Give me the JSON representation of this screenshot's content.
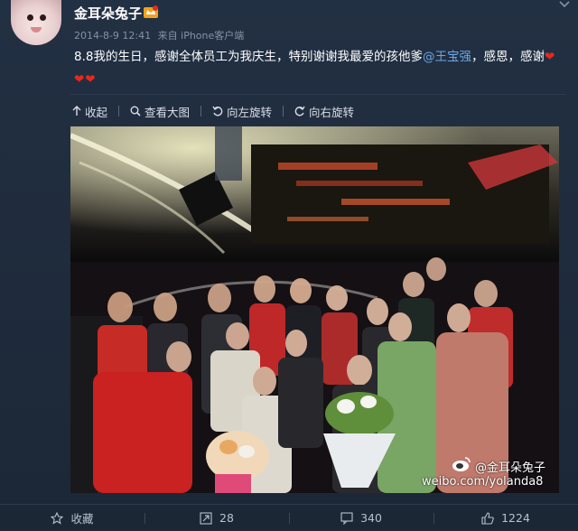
{
  "post": {
    "username": "金耳朵兔子",
    "vip_icon": "vip-crown-icon",
    "timestamp": "2014-8-9 12:41",
    "source_prefix": "来自",
    "source": "iPhone客户端",
    "text_before_mention": "8.8我的生日，感谢全体员工为我庆生，特别谢谢我最爱的孩他爹",
    "mention": "@王宝强",
    "text_after_mention": "，感恩，感谢",
    "hearts": "❤❤❤"
  },
  "toolbar": {
    "collapse_label": "收起",
    "view_large_label": "查看大图",
    "rotate_left_label": "向左旋转",
    "rotate_right_label": "向右旋转"
  },
  "photo": {
    "watermark_name": "@金耳朵兔子",
    "watermark_url": "weibo.com/yolanda8"
  },
  "actions": {
    "favorite_label": "收藏",
    "forward_count": "28",
    "comment_count": "340",
    "like_count": "1224"
  },
  "colors": {
    "background": "#1f2a38",
    "mention": "#6aa7e6",
    "heart": "#e8281e",
    "meta": "#8592a4"
  }
}
